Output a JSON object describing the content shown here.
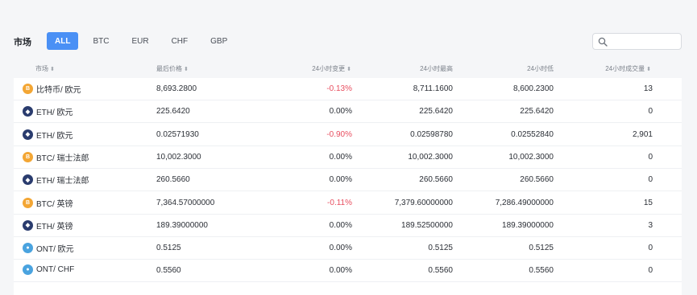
{
  "header": {
    "market_label": "市场",
    "filters": [
      "ALL",
      "BTC",
      "EUR",
      "CHF",
      "GBP"
    ],
    "active_filter": "ALL",
    "search_placeholder": ""
  },
  "columns": {
    "market": "市场",
    "last_price": "最后价格",
    "change_24h": "24小时变更",
    "high_24h": "24小时最高",
    "low_24h": "24小时低",
    "volume_24h": "24小时成交量",
    "sort_glyph": "⬍"
  },
  "rows": [
    {
      "coin": "btc",
      "pair": "比特币/ 欧元",
      "last": "8,693.2800",
      "change": "-0.13%",
      "negative": true,
      "high": "8,711.1600",
      "low": "8,600.2300",
      "volume": "13"
    },
    {
      "coin": "eth",
      "pair": "ETH/ 欧元",
      "last": "225.6420",
      "change": "0.00%",
      "negative": false,
      "high": "225.6420",
      "low": "225.6420",
      "volume": "0"
    },
    {
      "coin": "eth",
      "pair": "ETH/ 欧元",
      "last": "0.02571930",
      "change": "-0.90%",
      "negative": true,
      "high": "0.02598780",
      "low": "0.02552840",
      "volume": "2,901"
    },
    {
      "coin": "btc",
      "pair": "BTC/ 瑞士法郎",
      "last": "10,002.3000",
      "change": "0.00%",
      "negative": false,
      "high": "10,002.3000",
      "low": "10,002.3000",
      "volume": "0"
    },
    {
      "coin": "eth",
      "pair": "ETH/ 瑞士法郎",
      "last": "260.5660",
      "change": "0.00%",
      "negative": false,
      "high": "260.5660",
      "low": "260.5660",
      "volume": "0"
    },
    {
      "coin": "btc",
      "pair": "BTC/ 英镑",
      "last": "7,364.57000000",
      "change": "-0.11%",
      "negative": true,
      "high": "7,379.60000000",
      "low": "7,286.49000000",
      "volume": "15"
    },
    {
      "coin": "eth",
      "pair": "ETH/ 英镑",
      "last": "189.39000000",
      "change": "0.00%",
      "negative": false,
      "high": "189.52500000",
      "low": "189.39000000",
      "volume": "3"
    },
    {
      "coin": "ont",
      "pair": "ONT/ 欧元",
      "last": "0.5125",
      "change": "0.00%",
      "negative": false,
      "high": "0.5125",
      "low": "0.5125",
      "volume": "0"
    },
    {
      "coin": "ont",
      "pair": "ONT/ CHF",
      "last": "0.5560",
      "change": "0.00%",
      "negative": false,
      "high": "0.5560",
      "low": "0.5560",
      "volume": "0"
    }
  ],
  "colors": {
    "accent": "#4a90f5",
    "negative": "#e84e5f",
    "btc": "#f3a634",
    "eth": "#2a3c6e",
    "ont": "#4aa3df"
  }
}
